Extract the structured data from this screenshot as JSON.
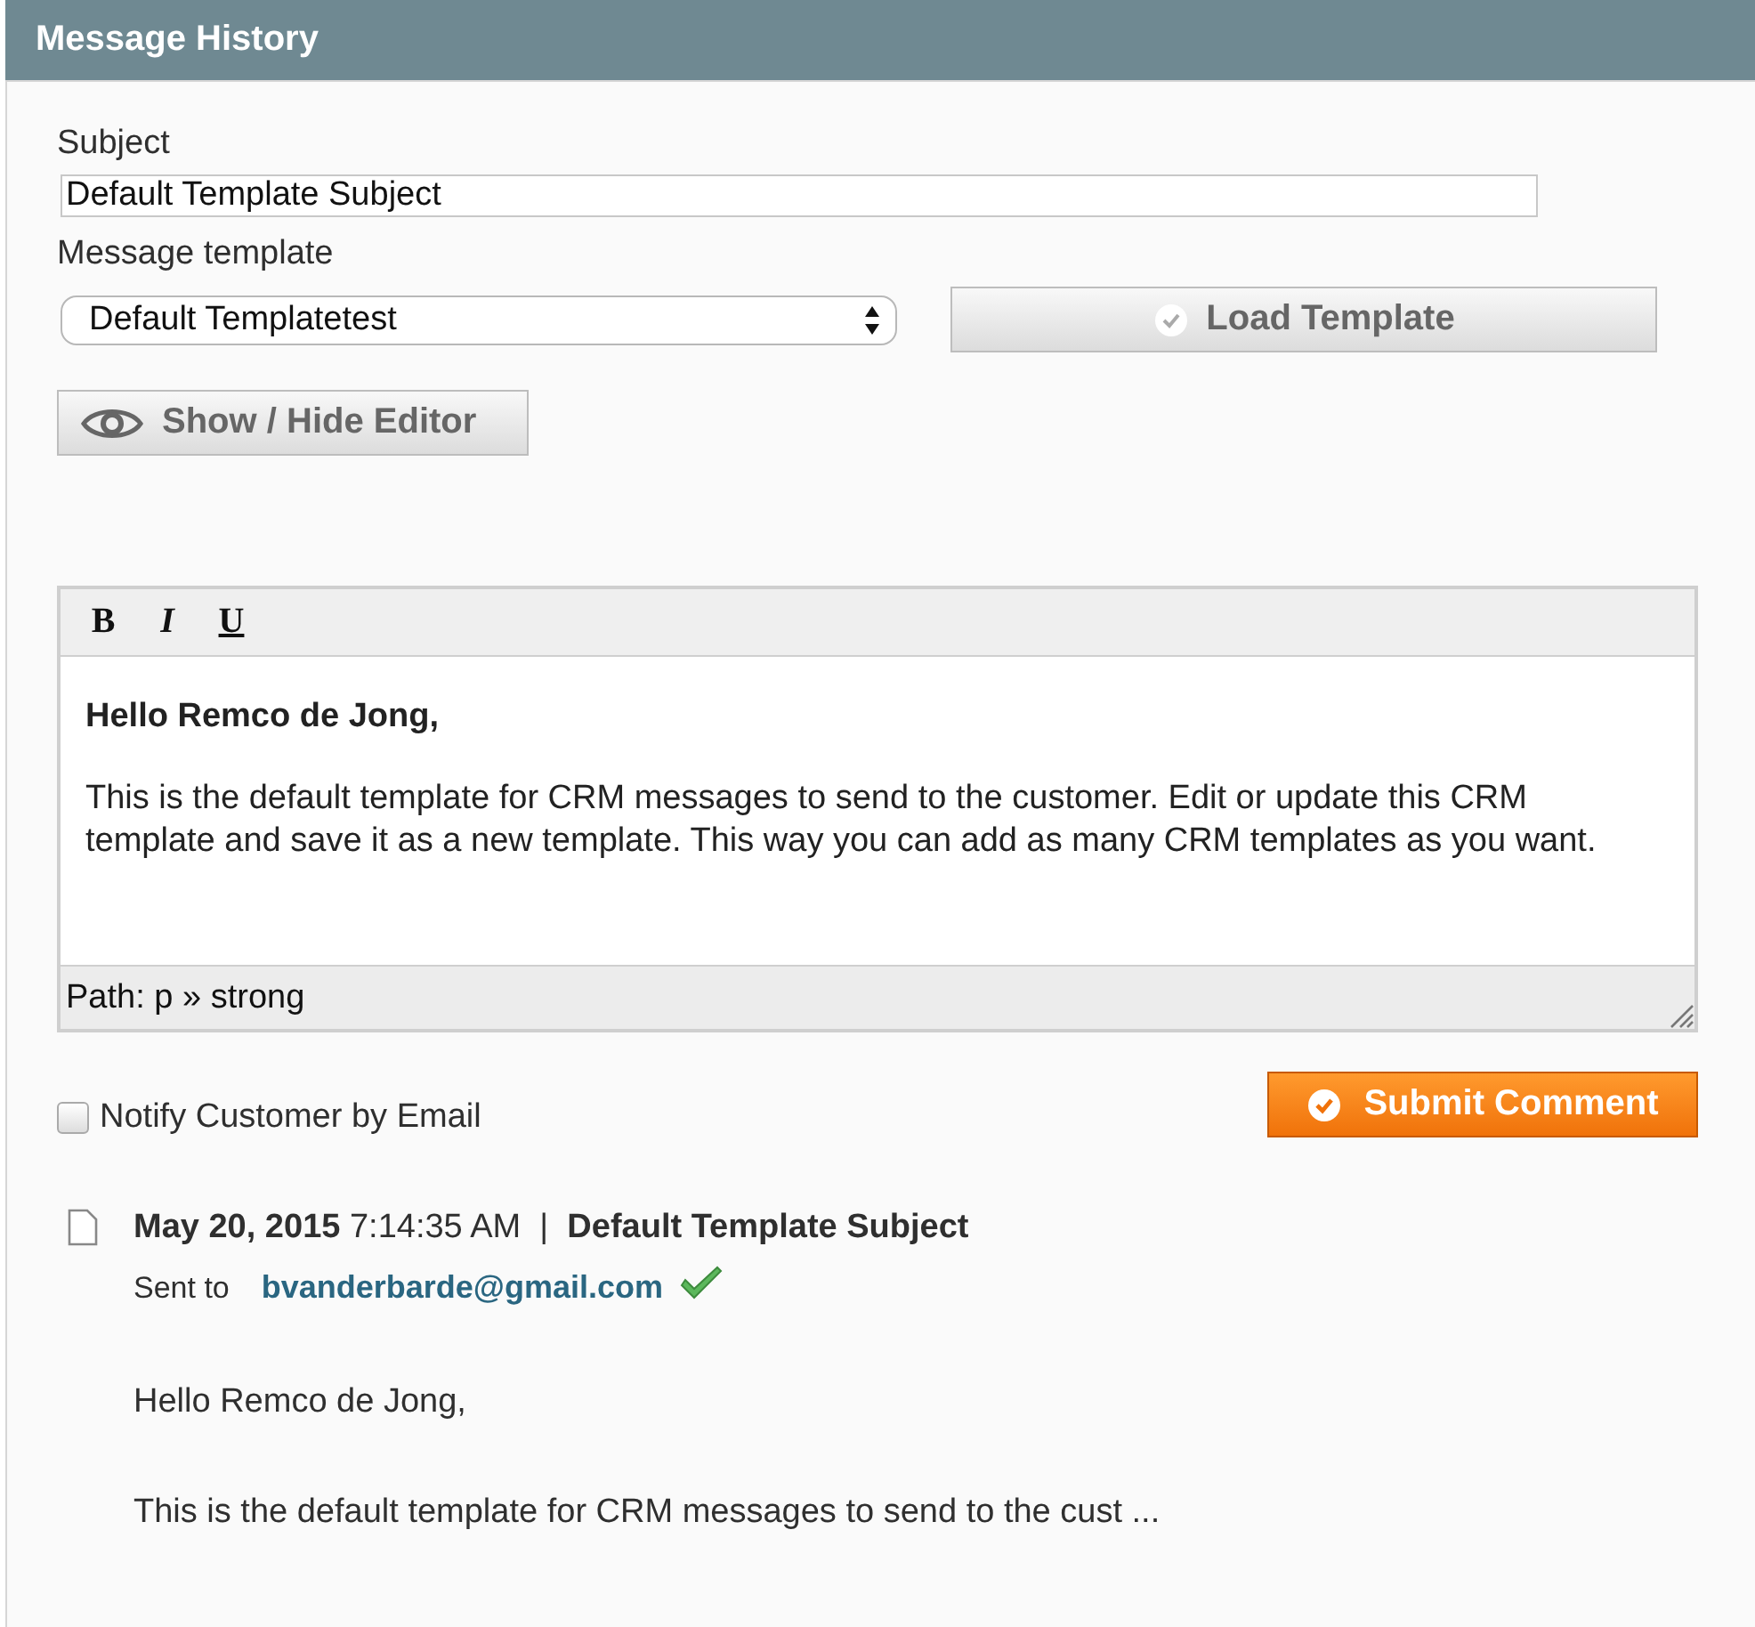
{
  "panel": {
    "title": "Message History"
  },
  "form": {
    "subject_label": "Subject",
    "subject_value": "Default Template Subject",
    "template_label": "Message template",
    "template_value": "Default Templatetest",
    "load_button": "Load Template",
    "toggle_editor_button": "Show / Hide Editor"
  },
  "editor": {
    "toolbar": [
      {
        "label": "B",
        "kind": "bold"
      },
      {
        "label": "I",
        "kind": "italic"
      },
      {
        "label": "U",
        "kind": "underline"
      }
    ],
    "greeting": "Hello Remco de Jong,",
    "body": "This is the default template for CRM messages to send to the customer. Edit or update this CRM template and save it as a new template. This way you can add as many CRM templates as you want.",
    "path": "Path: p » strong"
  },
  "notify": {
    "label": "Notify Customer by Email",
    "checked": false
  },
  "submit_button": "Submit Comment",
  "history": [
    {
      "heading": "**May 20, 2015** 7:14:35 AM  |  **Default Template Subject**",
      "sent_to_label": "Sent to",
      "email": "bvanderbarde@gmail.com",
      "delivered": true,
      "greeting": "Hello Remco de Jong,",
      "excerpt": "This is the default template for CRM messages to send to the cust ..."
    }
  ]
}
